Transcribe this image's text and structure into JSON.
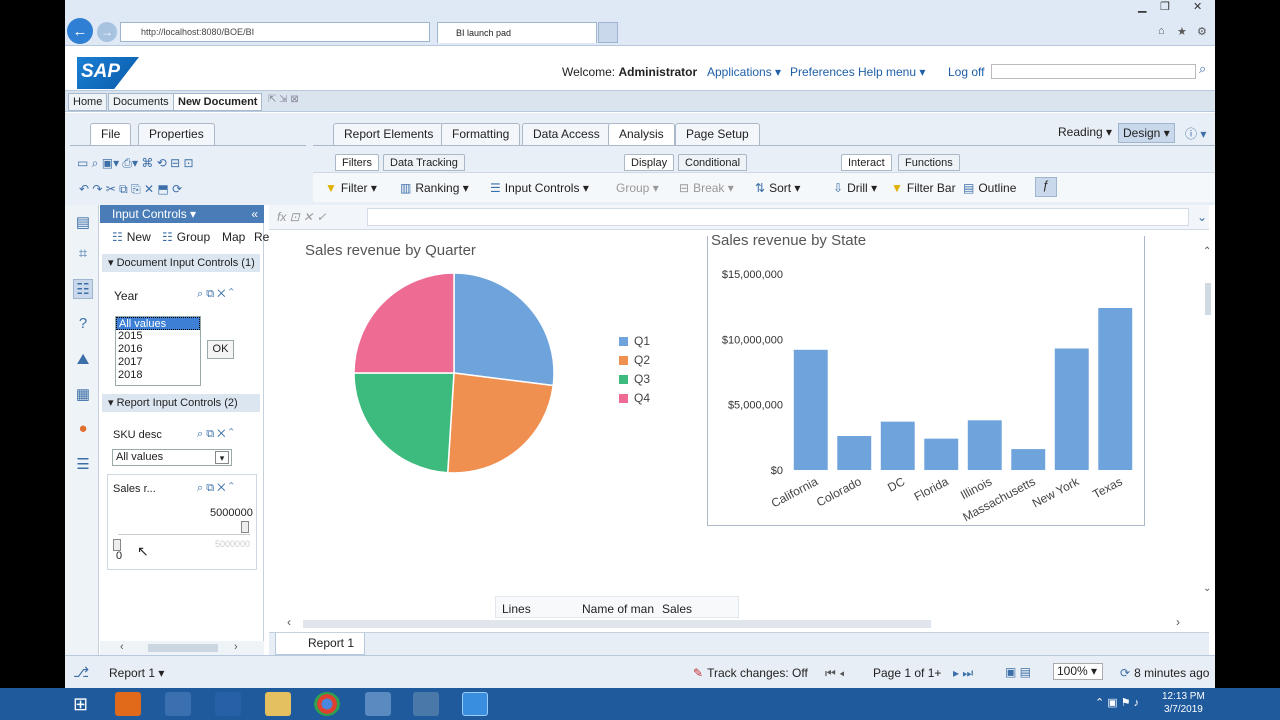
{
  "browser": {
    "url": "http://localhost:8080/BOE/BI",
    "tab_title": "BI launch pad"
  },
  "header": {
    "welcome_prefix": "Welcome:",
    "user": "Administrator",
    "applications": "Applications ▾",
    "preferences": "Preferences",
    "help_menu": "Help menu ▾",
    "logoff": "Log off",
    "logo": "SAP"
  },
  "doc_tabs": [
    "Home",
    "Documents",
    "New Document"
  ],
  "left_tabs": [
    "File",
    "Properties"
  ],
  "main_tabs": [
    "Report Elements",
    "Formatting",
    "Data Access",
    "Analysis",
    "Page Setup"
  ],
  "view_modes": {
    "reading": "Reading",
    "design": "Design"
  },
  "sub_tabs": [
    "Filters",
    "Data Tracking",
    "Display",
    "Conditional",
    "Interact",
    "Functions"
  ],
  "tools": {
    "filter": "Filter",
    "ranking": "Ranking",
    "input_controls": "Input Controls",
    "group": "Group",
    "break": "Break",
    "sort": "Sort",
    "drill": "Drill",
    "filter_bar": "Filter Bar",
    "outline": "Outline"
  },
  "input_panel": {
    "title": "Input Controls",
    "new": "New",
    "group": "Group",
    "map": "Map",
    "re": "Re",
    "doc_section": "Document Input Controls (1)",
    "report_section": "Report Input Controls (2)",
    "year_label": "Year",
    "year_options": [
      "All values",
      "2015",
      "2016",
      "2017",
      "2018"
    ],
    "ok": "OK",
    "sku_label": "SKU desc",
    "sku_value": "All values",
    "sales_label": "Sales r...",
    "slider_max": "5000000",
    "slider_max_faint": "5000000",
    "slider_min": "0"
  },
  "report": {
    "table_headers": [
      "Lines",
      "Name of man",
      "Sales revenue"
    ],
    "tab": "Report 1"
  },
  "chart_data": [
    {
      "type": "pie",
      "title": "Sales revenue by Quarter",
      "categories": [
        "Q1",
        "Q2",
        "Q3",
        "Q4"
      ],
      "values": [
        27,
        24,
        24,
        25
      ],
      "colors": [
        "#6fa3dc",
        "#ef8f50",
        "#3dba7d",
        "#ee6b93"
      ]
    },
    {
      "type": "bar",
      "title": "Sales revenue by State",
      "categories": [
        "California",
        "Colorado",
        "DC",
        "Florida",
        "Illinois",
        "Massachusetts",
        "New York",
        "Texas"
      ],
      "values": [
        9200000,
        2600000,
        3700000,
        2400000,
        3800000,
        1600000,
        9300000,
        12400000
      ],
      "yticks": [
        "$0",
        "$5,000,000",
        "$10,000,000",
        "$15,000,000"
      ],
      "ylim": [
        0,
        15000000
      ],
      "color": "#6fa3dc"
    }
  ],
  "status": {
    "report": "Report 1 ▾",
    "track_changes": "Track changes: Off",
    "page": "Page 1 of 1+",
    "zoom": "100%",
    "refresh": "8 minutes ago"
  },
  "taskbar": {
    "time": "12:13 PM",
    "date": "3/7/2019"
  }
}
